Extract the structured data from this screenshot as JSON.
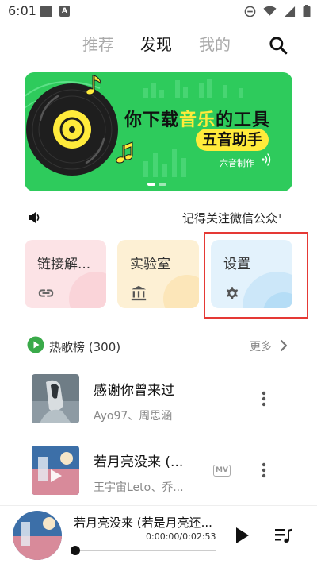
{
  "status": {
    "time": "6:01",
    "icons": [
      "photo-icon",
      "a-icon",
      "dnd-icon",
      "wifi-icon",
      "signal-icon",
      "battery-icon"
    ]
  },
  "nav": {
    "tabs": [
      {
        "label": "推荐",
        "active": false
      },
      {
        "label": "发现",
        "active": true
      },
      {
        "label": "我的",
        "active": false
      }
    ],
    "search_icon": "search-icon"
  },
  "banner": {
    "title_prefix": "你下载",
    "title_accent": "音乐",
    "title_suffix": "的工具",
    "subtitle": "五音助手",
    "credit": "六音制作",
    "pages": 2,
    "current_page": 1,
    "colors": {
      "background": "#2ecb5c",
      "accent": "#ffeb3b"
    }
  },
  "notice": {
    "icon": "speaker-icon",
    "text": "记得关注微信公众¹"
  },
  "cards": [
    {
      "label": "链接解...",
      "icon": "link-icon",
      "color": "#fce3e6"
    },
    {
      "label": "实验室",
      "icon": "bank-icon",
      "color": "#fdf0d4"
    },
    {
      "label": "设置",
      "icon": "gear-icon",
      "color": "#e3f2fc"
    }
  ],
  "hot": {
    "title": "热歌榜 (300)",
    "more": "更多",
    "color": "#3aaa4a"
  },
  "songs": [
    {
      "title": "感谢你曾来过",
      "artist": "Ayo97、周思涵",
      "mv": false
    },
    {
      "title": "若月亮没来 (...",
      "artist": "王宇宙Leto、乔...",
      "mv": true,
      "mv_label": "MV"
    }
  ],
  "player": {
    "title": "若月亮没来 (若是月亮还...",
    "time": "0:00:00/0:02:53",
    "progress": 0
  }
}
